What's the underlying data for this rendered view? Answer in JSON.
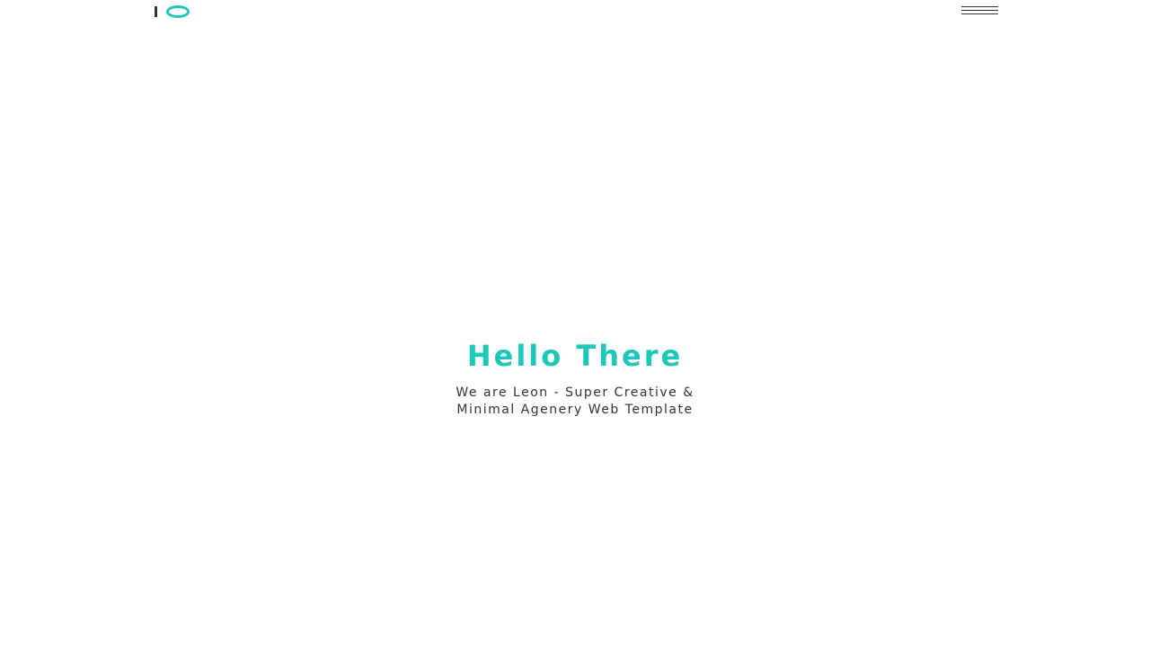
{
  "header": {
    "logo_icon": "io-logo-icon",
    "menu_icon": "hamburger-menu-icon"
  },
  "hero": {
    "title": "Hello There",
    "subtitle_line1": "We are Leon - Super Creative &",
    "subtitle_line2": "Minimal Agenery Web Template"
  },
  "colors": {
    "accent": "#1ec8b8",
    "logo_bar": "#2b3a3a",
    "text": "#333333",
    "background": "#ffffff"
  }
}
